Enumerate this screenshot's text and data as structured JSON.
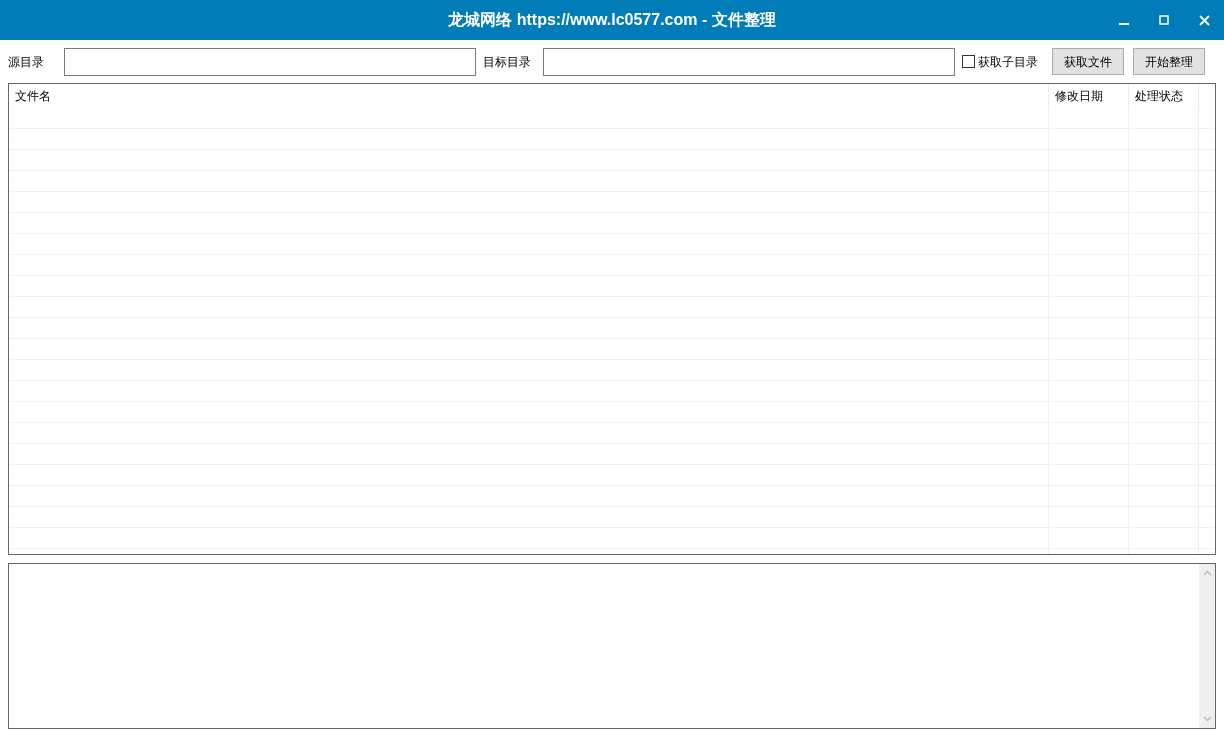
{
  "window": {
    "title": "龙城网络 https://www.lc0577.com - 文件整理"
  },
  "toolbar": {
    "source_label": "源目录",
    "target_label": "目标目录",
    "subdir_checkbox": {
      "label": "获取子目录",
      "checked": false
    },
    "buttons": [
      {
        "label": "获取文件"
      },
      {
        "label": "开始整理"
      }
    ]
  },
  "table": {
    "columns": [
      "文件名",
      "修改日期",
      "处理状态"
    ]
  }
}
